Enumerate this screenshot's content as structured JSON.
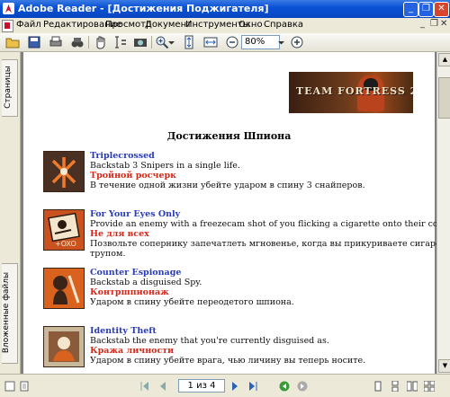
{
  "window": {
    "title": "Adobe Reader - [Достижения Поджигателя]"
  },
  "menu": {
    "items": [
      "Файл",
      "Редактирование",
      "Просмотр",
      "Документ",
      "Инструменты",
      "Окно",
      "Справка"
    ]
  },
  "toolbar": {
    "zoom_value": "80%"
  },
  "side_tabs": {
    "pages": "Страницы",
    "attachments": "Вложенные файлы"
  },
  "document": {
    "banner_text": "TEAM FORTRESS 2",
    "heading": "Достижения Шпиона",
    "achievements": [
      {
        "title": "Triplecrossed",
        "desc_en": "Backstab 3 Snipers in a single life.",
        "title_ru": "Тройной росчерк",
        "desc_ru": [
          "В течение одной жизни убейте ударом в спину 3 снайперов."
        ]
      },
      {
        "title": "For Your Eyes Only",
        "desc_en": "Provide an enemy with a freezecam shot of you flicking a cigarette onto their corpse.",
        "title_ru": "Не для всех",
        "desc_ru": [
          "Позвольте сопернику запечатлеть мгновенье, когда вы прикуриваете сигарету над его",
          "трупом."
        ]
      },
      {
        "title": "Counter Espionage",
        "desc_en": "Backstab a disguised Spy.",
        "title_ru": "Контршпионаж",
        "desc_ru": [
          "Ударом в спину убейте переодетого шпиона."
        ]
      },
      {
        "title": "Identity Theft",
        "desc_en": "Backstab the enemy that you're currently disguised as.",
        "title_ru": "Кража личности",
        "desc_ru": [
          "Ударом в спину убейте врага, чью личину вы теперь носите."
        ]
      }
    ]
  },
  "statusbar": {
    "page_indicator": "1 из 4"
  }
}
